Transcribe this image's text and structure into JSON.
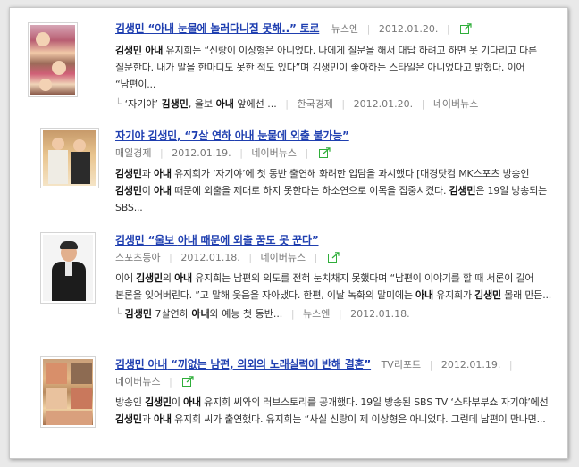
{
  "results": [
    {
      "title_parts": [
        {
          "t": "김생민",
          "b": true
        },
        {
          "t": " “",
          "b": false
        },
        {
          "t": "아내",
          "b": true
        },
        {
          "t": " 눈물에 놀러다니질 못해..” 토로",
          "b": false
        }
      ],
      "source": "뉴스엔",
      "date": "2012.01.20.",
      "portal": "",
      "desc_parts": [
        {
          "t": "김생민 아내",
          "b": true
        },
        {
          "t": " 유지희는 “신랑이 이상형은 아니었다. 나에게 질문을 해서 대답 하려고 하면 못 기다리고 다른 질문한다. 내가 말을 한마디도 못한 적도 있다”며 김생민이 좋아하는 스타일은 아니었다고 밝혔다. 이어 “남편이...",
          "b": false
        }
      ],
      "related": {
        "link_parts": [
          {
            "t": "‘자기야’ ",
            "b": false
          },
          {
            "t": "김생민",
            "b": true
          },
          {
            "t": ", 울보 ",
            "b": false
          },
          {
            "t": "아내",
            "b": true
          },
          {
            "t": " 앞에선 ...",
            "b": false
          }
        ],
        "source": "한국경제",
        "date": "2012.01.20.",
        "portal": "네이버뉴스"
      }
    },
    {
      "title_parts": [
        {
          "t": "자기야 ",
          "b": false
        },
        {
          "t": "김생민",
          "b": true
        },
        {
          "t": ", “7살 연하 ",
          "b": false
        },
        {
          "t": "아내",
          "b": true
        },
        {
          "t": " 눈물에 외출 불가능”",
          "b": false
        }
      ],
      "source": "매일경제",
      "date": "2012.01.19.",
      "portal": "네이버뉴스",
      "desc_parts": [
        {
          "t": "김생민",
          "b": true
        },
        {
          "t": "과 ",
          "b": false
        },
        {
          "t": "아내",
          "b": true
        },
        {
          "t": " 유지희가 ‘자기야’에 첫 동반 출연해 화려한 입담을 과시했다 [매경닷컴 MK스포츠 방송인 ",
          "b": false
        },
        {
          "t": "김생민",
          "b": true
        },
        {
          "t": "이 ",
          "b": false
        },
        {
          "t": "아내",
          "b": true
        },
        {
          "t": " 때문에 외출을 제대로 하지 못한다는 하소연으로 이목을 집중시켰다. ",
          "b": false
        },
        {
          "t": "김생민",
          "b": true
        },
        {
          "t": "은 19일 방송되는 SBS...",
          "b": false
        }
      ],
      "related": null
    },
    {
      "title_parts": [
        {
          "t": "김생민",
          "b": true
        },
        {
          "t": " “울보 ",
          "b": false
        },
        {
          "t": "아내",
          "b": true
        },
        {
          "t": " 때문에 외출 꿈도 못 꾼다”",
          "b": false
        }
      ],
      "source": "스포츠동아",
      "date": "2012.01.18.",
      "portal": "네이버뉴스",
      "desc_parts": [
        {
          "t": "이에 ",
          "b": false
        },
        {
          "t": "김생민",
          "b": true
        },
        {
          "t": "의 ",
          "b": false
        },
        {
          "t": "아내",
          "b": true
        },
        {
          "t": " 유지희는 남편의 의도를 전혀 눈치채지 못했다며 “남편이 이야기를 할 때 서론이 길어 본론을 잊어버린다. ”고 말해 웃음을 자아냈다. 한편, 이날 녹화의 말미에는 ",
          "b": false
        },
        {
          "t": "아내",
          "b": true
        },
        {
          "t": " 유지희가 ",
          "b": false
        },
        {
          "t": "김생민",
          "b": true
        },
        {
          "t": " 몰래 만든...",
          "b": false
        }
      ],
      "related": {
        "link_parts": [
          {
            "t": "김생민",
            "b": true
          },
          {
            "t": " 7살연하 ",
            "b": false
          },
          {
            "t": "아내",
            "b": true
          },
          {
            "t": "와 예능 첫 동반...",
            "b": false
          }
        ],
        "source": "뉴스엔",
        "date": "2012.01.18.",
        "portal": ""
      }
    },
    {
      "title_parts": [
        {
          "t": "김생민 아내",
          "b": true
        },
        {
          "t": " “끼없는 남편, 의외의 노래실력에 반해 결혼”",
          "b": false
        }
      ],
      "source": "TV리포트",
      "date": "2012.01.19.",
      "portal": "네이버뉴스",
      "desc_parts": [
        {
          "t": "방송인 ",
          "b": false
        },
        {
          "t": "김생민",
          "b": true
        },
        {
          "t": "이 ",
          "b": false
        },
        {
          "t": "아내",
          "b": true
        },
        {
          "t": " 유지희 씨와의 러브스토리를 공개했다. 19일 방송된 SBS TV ‘스타부부쇼 자기야’에선 ",
          "b": false
        },
        {
          "t": "김생민",
          "b": true
        },
        {
          "t": "과 ",
          "b": false
        },
        {
          "t": "아내",
          "b": true
        },
        {
          "t": " 유지희 씨가 출연했다. 유지희는 “사실 신랑이 제 이상형은 아니었다. 그런데 남편이 만나면...",
          "b": false
        }
      ],
      "related": null
    }
  ],
  "icons": {
    "share": "share-external-icon",
    "related_corner": "corner-arrow-icon"
  },
  "colors": {
    "link": "#1f3fb0",
    "meta": "#777777",
    "share_icon": "#2fae3a"
  }
}
